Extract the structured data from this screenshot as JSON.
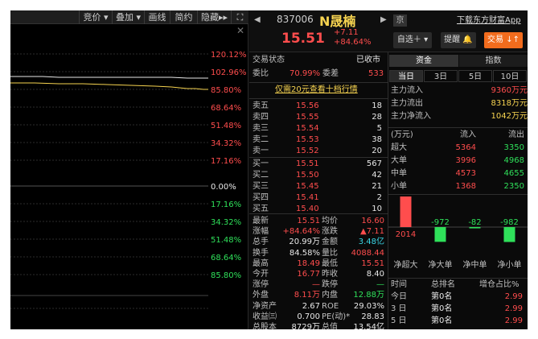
{
  "toolbar": {
    "items": [
      "竞价",
      "叠加",
      "画线",
      "简约",
      "隐藏"
    ]
  },
  "chart": {
    "pct_labels": [
      "120.12%",
      "102.96%",
      "85.80%",
      "68.64%",
      "51.48%",
      "34.32%",
      "17.16%",
      "0.00%",
      "17.16%",
      "34.32%",
      "51.48%",
      "68.64%",
      "85.80%"
    ],
    "pct_colors": [
      "red",
      "red",
      "red",
      "red",
      "red",
      "red",
      "red",
      "wht",
      "grn",
      "grn",
      "grn",
      "grn",
      "grn"
    ]
  },
  "header": {
    "code": "837006",
    "name": "N晟楠",
    "price": "15.51",
    "change": "+7.11",
    "change_pct": "+84.64%",
    "market_badge": "京",
    "download": "下载东方财富App",
    "buttons": {
      "watchlist": "自选＋",
      "alert": "提醒",
      "trade": "交易"
    }
  },
  "summary": {
    "status_label": "交易状态",
    "status_value": "已收市",
    "ratio_label": "委比",
    "ratio_value": "70.99%",
    "diff_label": "委差",
    "diff_value": "533",
    "promo": "仅需20元查看十档行情"
  },
  "sells": [
    {
      "label": "卖五",
      "price": "15.56",
      "vol": "18"
    },
    {
      "label": "卖四",
      "price": "15.55",
      "vol": "28"
    },
    {
      "label": "卖三",
      "price": "15.54",
      "vol": "5"
    },
    {
      "label": "卖二",
      "price": "15.53",
      "vol": "38"
    },
    {
      "label": "卖一",
      "price": "15.52",
      "vol": "20"
    }
  ],
  "buys": [
    {
      "label": "买一",
      "price": "15.51",
      "vol": "567"
    },
    {
      "label": "买二",
      "price": "15.50",
      "vol": "42"
    },
    {
      "label": "买三",
      "price": "15.45",
      "vol": "21"
    },
    {
      "label": "买四",
      "price": "15.41",
      "vol": "2"
    },
    {
      "label": "买五",
      "price": "15.40",
      "vol": "10"
    }
  ],
  "stats": [
    {
      "l1": "最新",
      "v1": "15.51",
      "c1": "red",
      "l2": "均价",
      "v2": "16.60",
      "c2": "red"
    },
    {
      "l1": "涨幅",
      "v1": "+84.64%",
      "c1": "red",
      "l2": "涨跌",
      "v2": "▲7.11",
      "c2": "red"
    },
    {
      "l1": "总手",
      "v1": "20.99万",
      "c1": "wht",
      "l2": "金额",
      "v2": "3.48亿",
      "c2": "cyan"
    },
    {
      "l1": "换手",
      "v1": "84.58%",
      "c1": "wht",
      "l2": "量比",
      "v2": "4088.44",
      "c2": "red"
    },
    {
      "l1": "最高",
      "v1": "18.49",
      "c1": "red",
      "l2": "最低",
      "v2": "15.51",
      "c2": "red"
    },
    {
      "l1": "今开",
      "v1": "16.77",
      "c1": "red",
      "l2": "昨收",
      "v2": "8.40",
      "c2": "wht"
    },
    {
      "l1": "涨停",
      "v1": "—",
      "c1": "red",
      "l2": "跌停",
      "v2": "—",
      "c2": "grn"
    },
    {
      "l1": "外盘",
      "v1": "8.11万",
      "c1": "red",
      "l2": "内盘",
      "v2": "12.88万",
      "c2": "grn"
    },
    {
      "l1": "净资产",
      "v1": "2.67",
      "c1": "wht",
      "l2": "ROE",
      "v2": "29.03%",
      "c2": "wht"
    },
    {
      "l1": "收益㈢",
      "v1": "0.700",
      "c1": "wht",
      "l2": "PE(动)*",
      "v2": "28.83",
      "c2": "wht"
    },
    {
      "l1": "总股本",
      "v1": "8729万",
      "c1": "wht",
      "l2": "总值",
      "v2": "13.54亿",
      "c2": "wht"
    }
  ],
  "fund": {
    "tabs": [
      "资金",
      "指数"
    ],
    "periods": [
      "当日",
      "3日",
      "5日",
      "10日"
    ],
    "flows": [
      {
        "label": "主力流入",
        "value": "9360",
        "unit": "万元",
        "color": "red"
      },
      {
        "label": "主力流出",
        "value": "8318",
        "unit": "万元",
        "color": "yel"
      },
      {
        "label": "主力净流入",
        "value": "1042",
        "unit": "万元",
        "color": "yel"
      }
    ],
    "table_head": [
      "(万元)",
      "流入",
      "流出"
    ],
    "table": [
      {
        "label": "超大",
        "in": "5364",
        "out": "3350"
      },
      {
        "label": "大单",
        "in": "3996",
        "out": "4968"
      },
      {
        "label": "中单",
        "in": "4573",
        "out": "4655"
      },
      {
        "label": "小单",
        "in": "1368",
        "out": "2350"
      }
    ],
    "bars": [
      {
        "label": "净超大",
        "value": 2014
      },
      {
        "label": "净大单",
        "value": -972
      },
      {
        "label": "净中单",
        "value": -82
      },
      {
        "label": "净小单",
        "value": -982
      }
    ],
    "bar_texts": [
      "2014",
      "-972",
      "-82",
      "-982"
    ],
    "rank_head": [
      "时间",
      "总排名",
      "增仓占比%"
    ],
    "ranks": [
      {
        "t": "今日",
        "r": "第0名",
        "p": "2.99"
      },
      {
        "t": "3 日",
        "r": "第0名",
        "p": "2.99"
      },
      {
        "t": "5 日",
        "r": "第0名",
        "p": "2.99"
      }
    ]
  }
}
